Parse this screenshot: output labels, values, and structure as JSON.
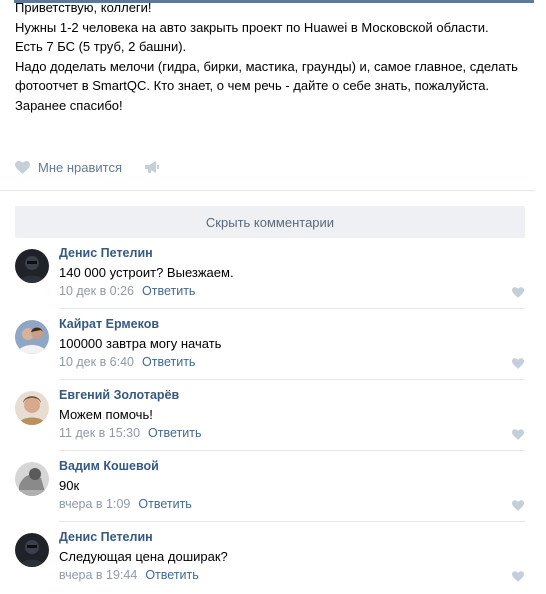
{
  "post": {
    "lines": [
      "Приветствую, коллеги!",
      "Нужны 1-2 человека на авто закрыть проект по Huawei в Московской области.",
      "Есть 7 БС (5 труб, 2 башни).",
      "Надо доделать мелочи (гидра, бирки, мастика, граунды) и, самое главное, сделать",
      "фотоотчет в SmartQC. Кто знает, о чем речь - дайте о себе знать, пожалуйста.",
      "Заранее спасибо!"
    ],
    "like_label": "Мне нравится",
    "like_icon": "heart-icon",
    "share_icon": "megaphone-icon"
  },
  "comments_section": {
    "hide_label": "Скрыть комментарии",
    "reply_label": "Ответить",
    "items": [
      {
        "author": "Денис Петелин",
        "text": "140 000 устроит? Выезжаем.",
        "date": "10 дек в 0:26",
        "like_icon": "heart-icon"
      },
      {
        "author": "Кайрат Ермеков",
        "text": "100000 завтра могу начать",
        "date": "10 дек в 6:40",
        "like_icon": "heart-icon"
      },
      {
        "author": "Евгений Золотарёв",
        "text": "Можем помочь!",
        "date": "11 дек в 15:30",
        "like_icon": "heart-icon"
      },
      {
        "author": "Вадим Кошевой",
        "text": "90к",
        "date": "вчера в 1:09",
        "like_icon": "heart-icon"
      },
      {
        "author": "Денис Петелин",
        "text": "Следующая цена доширак?",
        "date": "вчера в 19:44",
        "like_icon": "heart-icon"
      }
    ]
  },
  "colors": {
    "link": "#355a82",
    "reply": "#3f6994",
    "meta": "#8f9aa6",
    "icon": "#c4cfda",
    "button_bg": "#eef0f3"
  }
}
